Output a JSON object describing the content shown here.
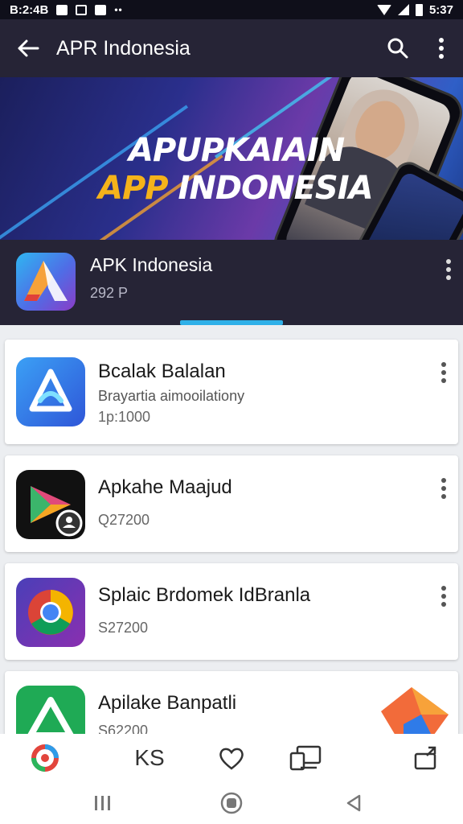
{
  "status_bar": {
    "time_left": "B:2:4B",
    "time_right": "5:37"
  },
  "app_bar": {
    "title": "APR Indonesia"
  },
  "banner": {
    "line1": "APUPKAIAIN",
    "line2_highlight": "APP",
    "line2_rest": " INDONESIA"
  },
  "featured": {
    "name": "APK Indonesia",
    "subtitle": "292 P"
  },
  "apps": [
    {
      "title": "Bcalak Balalan",
      "description": "Brayartia aimooilationy",
      "meta": "1p:1000"
    },
    {
      "title": "Apkahe Maajud",
      "description": "",
      "meta": "Q27200"
    },
    {
      "title": "Splaic Brdomek IdBranla",
      "description": "",
      "meta": "S27200"
    },
    {
      "title": "Apilake Banpatli",
      "description": "",
      "meta": "S62200"
    }
  ],
  "bottom_nav": {
    "item2_label": "KS"
  },
  "colors": {
    "app_bar": "#262436",
    "accent": "#2fb0e8",
    "highlight": "#f5b31a"
  }
}
